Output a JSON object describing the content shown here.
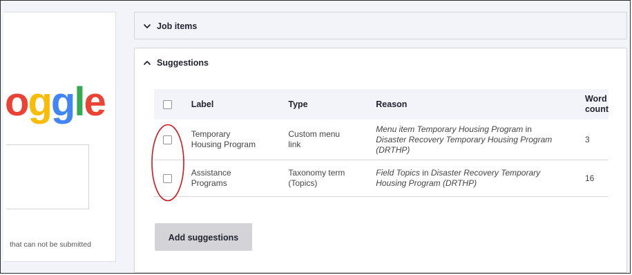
{
  "left_preview": {
    "logo_letters": [
      "o",
      "g",
      "l",
      "e"
    ],
    "note": "that can not be submitted"
  },
  "job_items": {
    "label": "Job items",
    "state": "collapsed"
  },
  "suggestions": {
    "label": "Suggestions",
    "state": "expanded",
    "table": {
      "headers": {
        "label": "Label",
        "type": "Type",
        "reason": "Reason",
        "word_count_line1": "Word",
        "word_count_line2": "count"
      },
      "rows": [
        {
          "checked": false,
          "label_line1": "Temporary",
          "label_line2": "Housing Program",
          "type_line1": "Custom menu",
          "type_line2": "link",
          "reason_part1": "Menu item Temporary Housing Program",
          "reason_part2": " in",
          "reason_part3": "Disaster Recovery Temporary Housing Program",
          "reason_part4": "(DRTHP)",
          "word_count": "3"
        },
        {
          "checked": false,
          "label_line1": "Assistance",
          "label_line2": "Programs",
          "type_line1": "Taxonomy term",
          "type_line2": "(Topics)",
          "reason_part1": "Field Topics",
          "reason_part2": " in ",
          "reason_part3": "Disaster Recovery Temporary",
          "reason_part4": "Housing Program (DRTHP)",
          "word_count": "16"
        }
      ]
    },
    "add_button_label": "Add suggestions"
  },
  "colors": {
    "annotation": "#d0151d",
    "google_red": "#ea4335",
    "google_yellow": "#fbbc05",
    "google_blue": "#4285f4",
    "google_green": "#34a853"
  }
}
